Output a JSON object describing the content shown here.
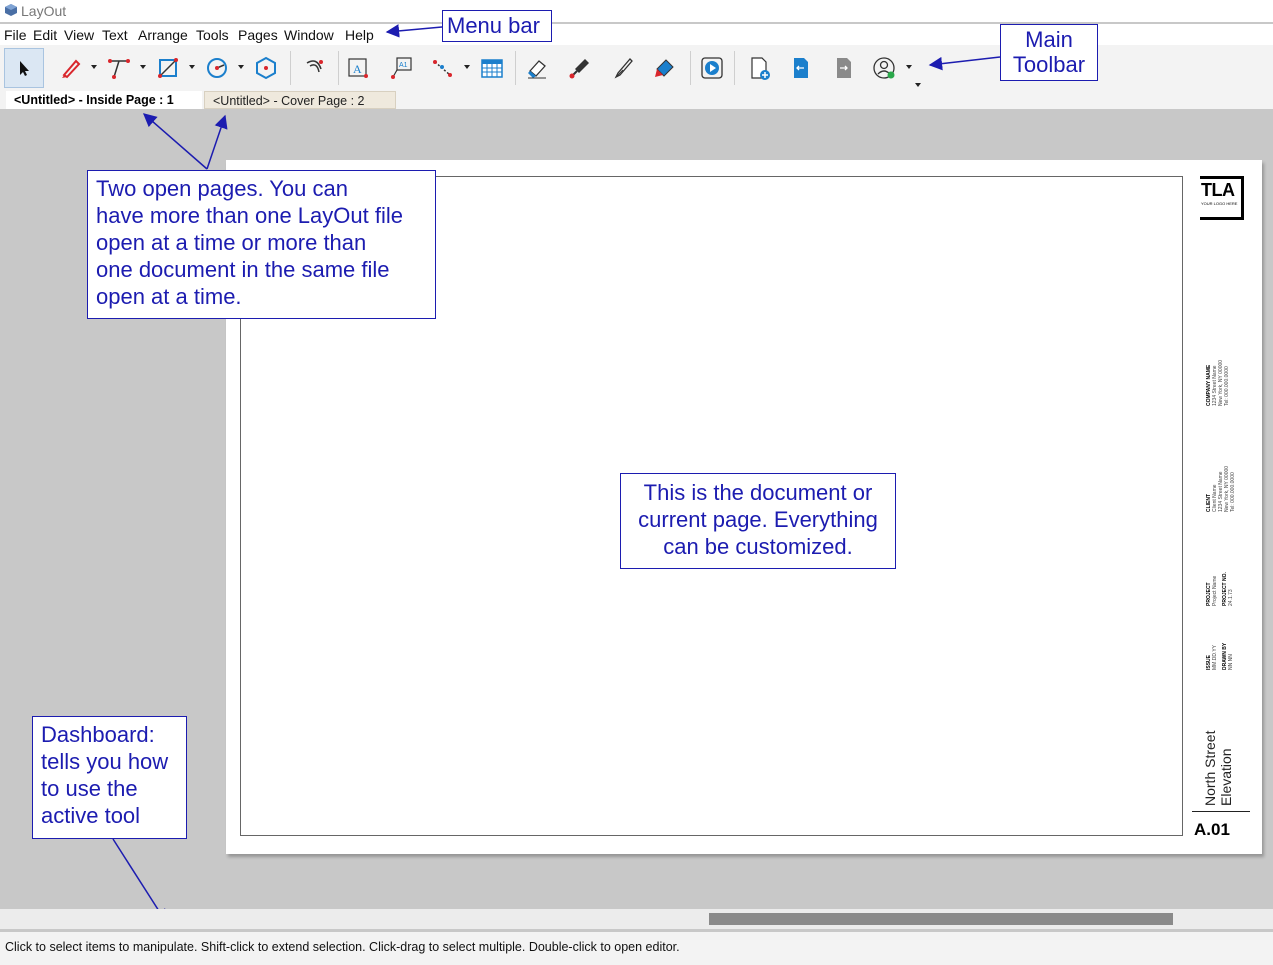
{
  "window": {
    "title": "LayOut"
  },
  "menu": [
    "File",
    "Edit",
    "View",
    "Text",
    "Arrange",
    "Tools",
    "Pages",
    "Window",
    "Help"
  ],
  "tabs": [
    {
      "label": "<Untitled> - Inside Page : 1",
      "active": true
    },
    {
      "label": "<Untitled> - Cover Page : 2",
      "active": false
    }
  ],
  "title_block": {
    "logo_text": "TLA",
    "logo_subtext": "YOUR LOGO HERE",
    "company": {
      "label": "COMPANY NAME",
      "lines": [
        "1234 Street Name",
        "New York, NY 00000",
        "Tel: 000.000.0000"
      ]
    },
    "client": {
      "label": "CLIENT",
      "lines": [
        "Client Name",
        "1234 Street Name",
        "New York, NY 00000",
        "Tel: 000.000.0000"
      ]
    },
    "project": {
      "label": "PROJECT",
      "value": "Project Name"
    },
    "project_no": {
      "label": "PROJECT NO.",
      "value": "24.1.73"
    },
    "issue": {
      "label": "ISSUE",
      "value": "MM.DD.YY"
    },
    "drawn_by": {
      "label": "DRAWN BY",
      "value": "NN NN"
    },
    "sheet_title": [
      "North Street",
      "Elevation"
    ],
    "sheet_number": "A.01"
  },
  "callouts": {
    "menu_bar": "Menu bar",
    "main_toolbar": [
      "Main",
      "Toolbar"
    ],
    "pages": [
      "Two open pages. You can",
      "have more than one LayOut file",
      "open at a time or more than",
      "one document in the same file",
      "open at a time."
    ],
    "document": [
      "This is the document or",
      "current page. Everything",
      "can be customized."
    ],
    "dashboard": [
      "Dashboard:",
      "tells you how",
      "to use the",
      "active tool"
    ]
  },
  "status": "Click to select items to manipulate. Shift-click to extend selection. Click-drag to select multiple. Double-click to open editor.",
  "colors": {
    "annotation": "#1c1cb0",
    "accent_red": "#d9262c",
    "accent_blue": "#1b7fcc"
  }
}
